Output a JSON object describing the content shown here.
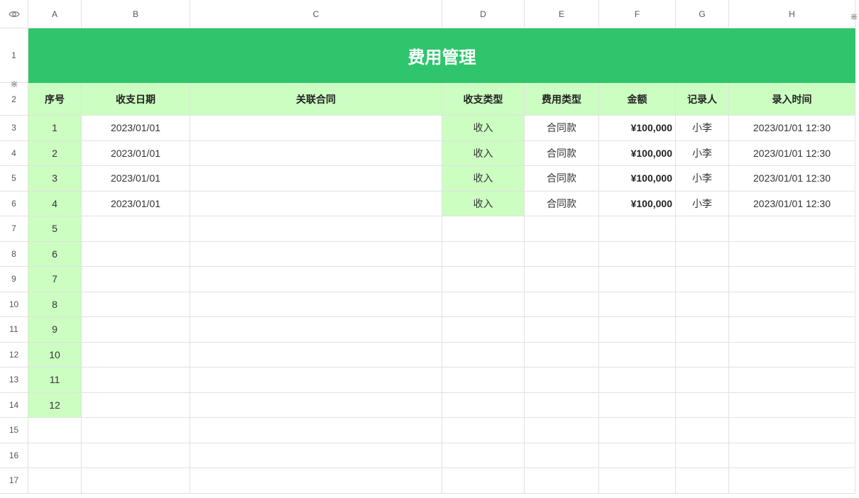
{
  "columns": [
    "A",
    "B",
    "C",
    "D",
    "E",
    "F",
    "G",
    "H"
  ],
  "row_numbers": [
    "1",
    "2",
    "3",
    "4",
    "5",
    "6",
    "7",
    "8",
    "9",
    "10",
    "11",
    "12",
    "13",
    "14",
    "15",
    "16",
    "17"
  ],
  "title": "费用管理",
  "headers": [
    "序号",
    "收支日期",
    "关联合同",
    "收支类型",
    "费用类型",
    "金额",
    "记录人",
    "录入时间"
  ],
  "records": [
    {
      "no": "1",
      "date": "2023/01/01",
      "contract": "",
      "flow": "收入",
      "fee_type": "合同款",
      "amount": "¥100,000",
      "recorder": "小李",
      "entered": "2023/01/01 12:30"
    },
    {
      "no": "2",
      "date": "2023/01/01",
      "contract": "",
      "flow": "收入",
      "fee_type": "合同款",
      "amount": "¥100,000",
      "recorder": "小李",
      "entered": "2023/01/01 12:30"
    },
    {
      "no": "3",
      "date": "2023/01/01",
      "contract": "",
      "flow": "收入",
      "fee_type": "合同款",
      "amount": "¥100,000",
      "recorder": "小李",
      "entered": "2023/01/01 12:30"
    },
    {
      "no": "4",
      "date": "2023/01/01",
      "contract": "",
      "flow": "收入",
      "fee_type": "合同款",
      "amount": "¥100,000",
      "recorder": "小李",
      "entered": "2023/01/01 12:30"
    }
  ],
  "extra_numbers": [
    "5",
    "6",
    "7",
    "8",
    "9",
    "10",
    "11",
    "12"
  ],
  "empty_rows": 3,
  "icons": {
    "corner": "eye-icon",
    "freeze": "freeze-pane-icon"
  },
  "colors": {
    "title_bg": "#2fc56c",
    "header_bg": "#ccfec2",
    "grid_line": "#e1e1e1"
  }
}
